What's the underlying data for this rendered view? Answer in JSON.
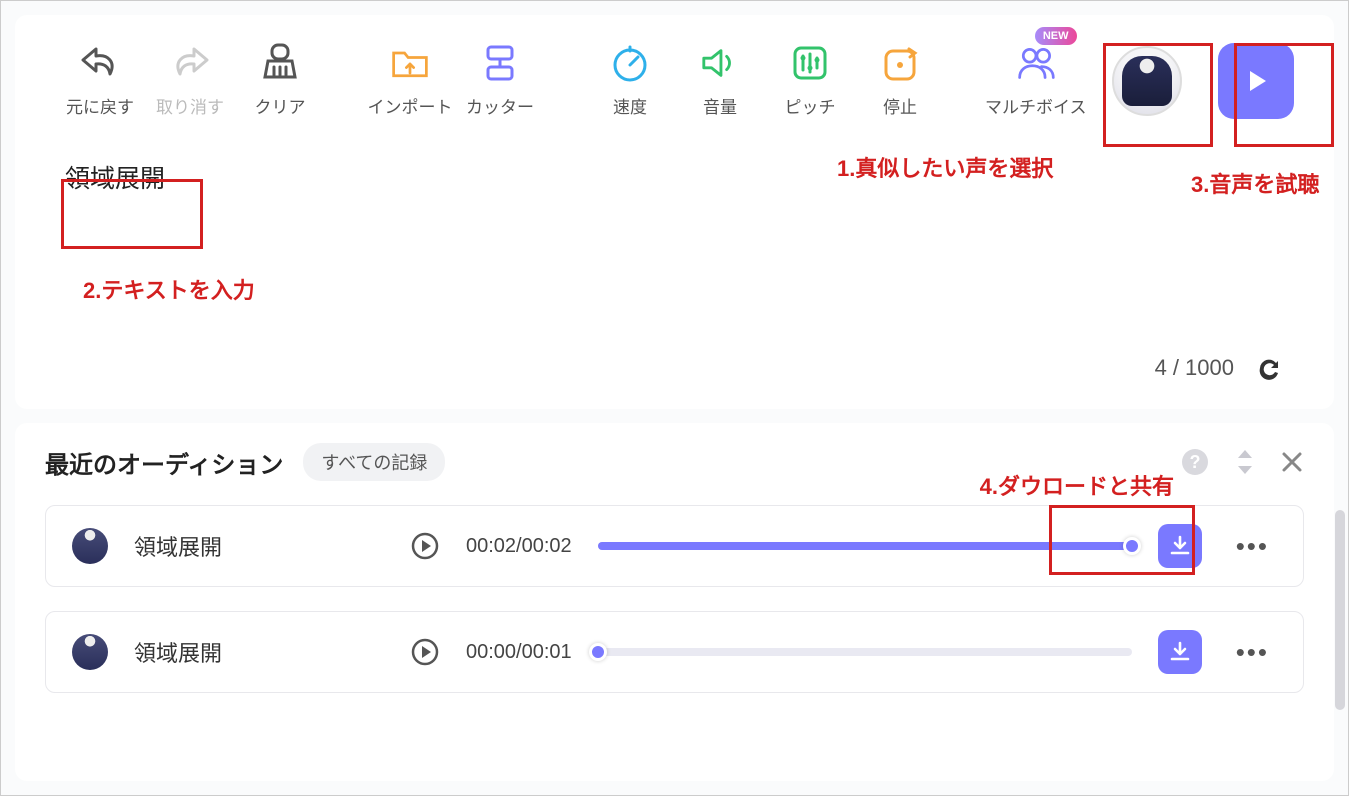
{
  "toolbar": {
    "undo": "元に戻す",
    "redo": "取り消す",
    "clear": "クリア",
    "import": "インポート",
    "cutter": "カッター",
    "speed": "速度",
    "volume": "音量",
    "pitch": "ピッチ",
    "stop": "停止",
    "multivoice": "マルチボイス",
    "new_badge": "NEW"
  },
  "editor": {
    "text": "領域展開",
    "count": "4",
    "sep": " / ",
    "max": "1000"
  },
  "auditions": {
    "title": "最近のオーディション",
    "all_records": "すべての記録",
    "rows": [
      {
        "title": "領域展開",
        "time": "00:02/00:02",
        "progress_pct": 100
      },
      {
        "title": "領域展開",
        "time": "00:00/00:01",
        "progress_pct": 0
      }
    ]
  },
  "annotations": {
    "a1": "1.真似したい声を選択",
    "a2": "2.テキストを入力",
    "a3": "3.音声を試聴",
    "a4": "4.ダウロードと共有"
  },
  "colors": {
    "accent": "#7a79ff",
    "annotation": "#d32020"
  }
}
